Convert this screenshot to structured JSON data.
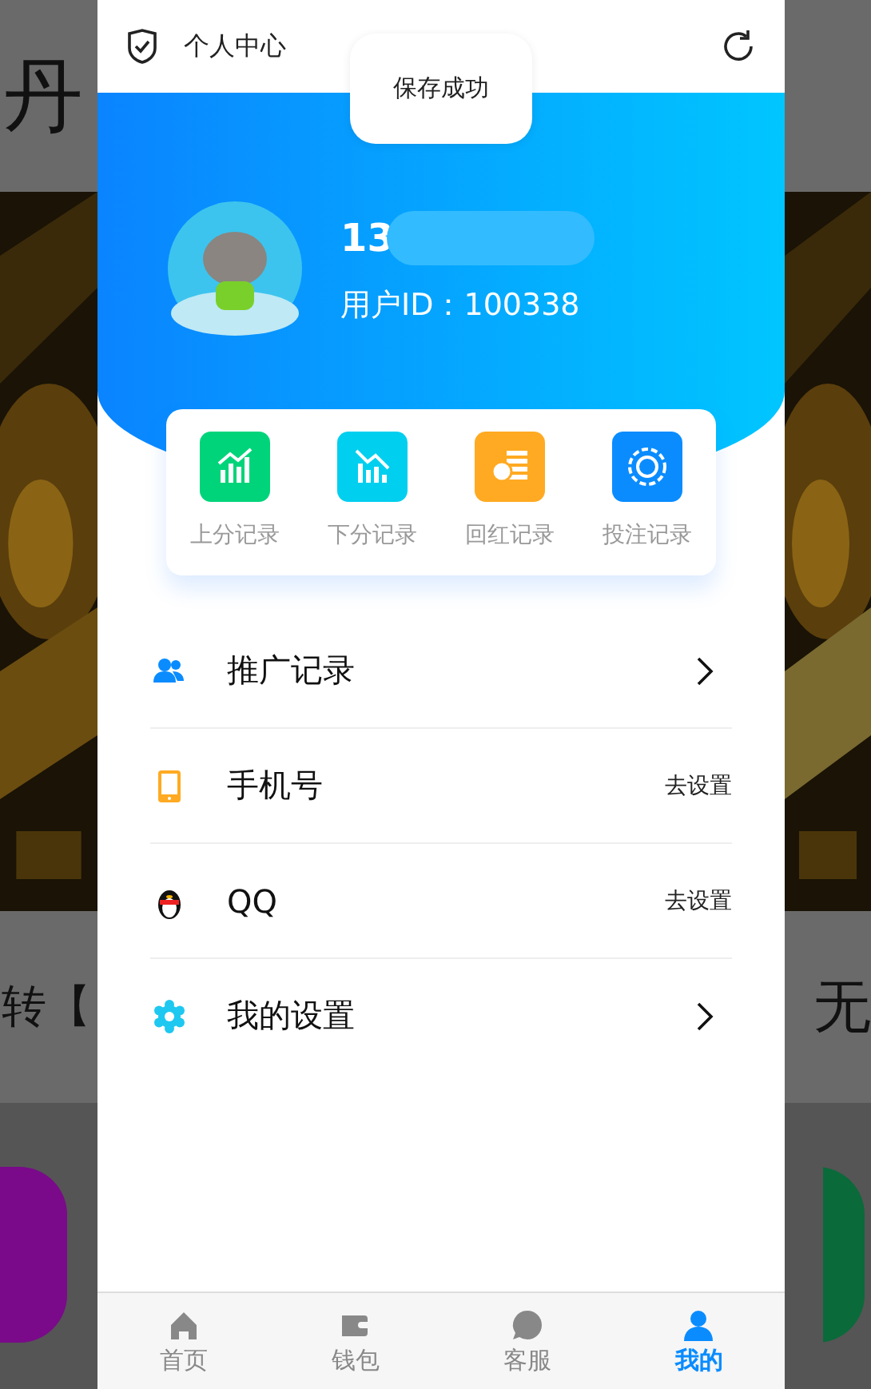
{
  "background": {
    "left_heading": "丹",
    "left_caption": "转【",
    "right_caption": "无"
  },
  "header": {
    "title": "个人中心"
  },
  "toast": {
    "text": "保存成功"
  },
  "profile": {
    "phone": "13",
    "user_id": "用户ID：100338"
  },
  "quick_links": [
    {
      "label": "上分记录",
      "color": "#00d47a"
    },
    {
      "label": "下分记录",
      "color": "#00cfef"
    },
    {
      "label": "回红记录",
      "color": "#ffaa22"
    },
    {
      "label": "投注记录",
      "color": "#0a8cff"
    }
  ],
  "menu": [
    {
      "label": "推广记录",
      "kind": "arrow"
    },
    {
      "label": "手机号",
      "kind": "action",
      "action": "去设置"
    },
    {
      "label": "QQ",
      "kind": "action",
      "action": "去设置"
    },
    {
      "label": "我的设置",
      "kind": "arrow"
    }
  ],
  "tab_bar": [
    {
      "label": "首页",
      "selected": false
    },
    {
      "label": "钱包",
      "selected": false
    },
    {
      "label": "客服",
      "selected": false
    },
    {
      "label": "我的",
      "selected": true
    }
  ]
}
